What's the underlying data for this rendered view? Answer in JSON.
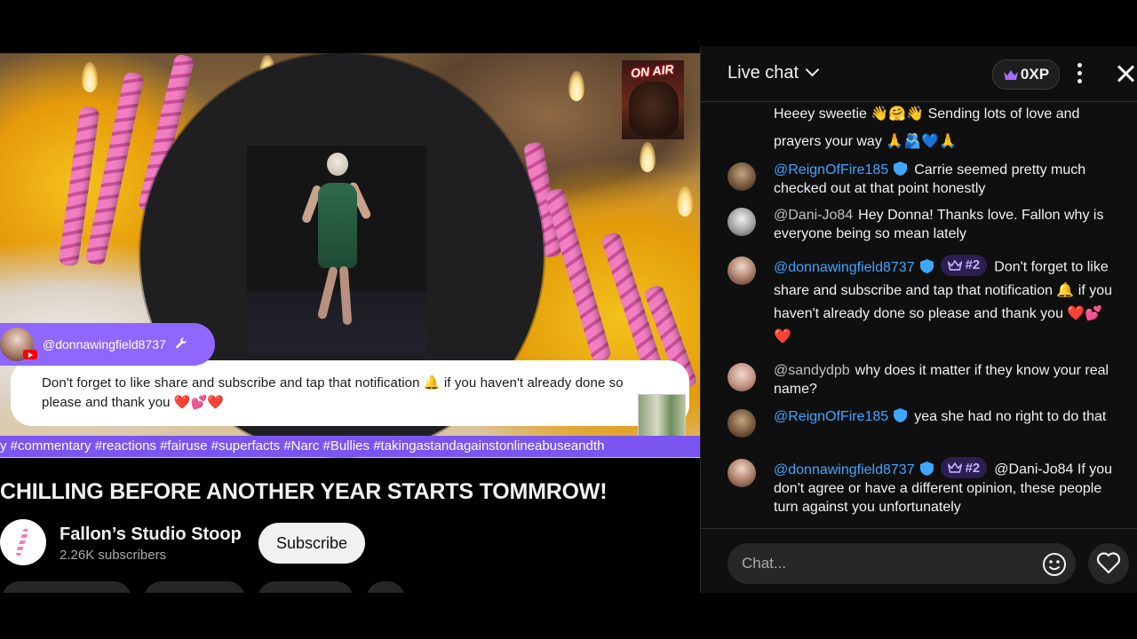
{
  "video": {
    "on_air_label": "ON AIR",
    "chat_overlay": {
      "username": "@donnawingfield8737",
      "message": "Don't forget to like share and subscribe and tap that notification 🔔 if you haven't already done so please and thank you ❤️💕❤️"
    },
    "ticker": "y #commentary #reactions #fairuse #superfacts #Narc #Bullies #takingastandagainstonlineabuseandth"
  },
  "title": "CHILLING BEFORE ANOTHER YEAR STARTS TOMMROW!",
  "channel": {
    "name": "Fallon’s Studio Stoop",
    "subscribers": "2.26K subscribers",
    "subscribe_label": "Subscribe"
  },
  "chat": {
    "title": "Live chat",
    "xp": "0XP",
    "input_placeholder": "Chat...",
    "messages": [
      {
        "author": "",
        "text": "Heeey sweetie 👋🤗👋 Sending lots of love and prayers your way 🙏🫂💙🙏"
      },
      {
        "author": "@ReignOfFire185",
        "text": "Carrie seemed pretty much checked out at that point honestly"
      },
      {
        "author": "@Dani-Jo84",
        "text": "Hey Donna! Thanks love. Fallon why is everyone being so mean lately"
      },
      {
        "author": "@donnawingfield8737",
        "rank": "#2",
        "text": "Don't forget to like share and subscribe and tap that notification 🔔 if you haven't already done so please and thank you ❤️💕❤️"
      },
      {
        "author": "@sandydpb",
        "text": "why does it matter if they know your real name?"
      },
      {
        "author": "@ReignOfFire185",
        "text": "yea she had no right to do that"
      },
      {
        "author": "@donnawingfield8737",
        "rank": "#2",
        "text": "@Dani-Jo84 If you don't agree or have a different opinion, these people turn against you unfortunately"
      }
    ]
  },
  "colors": {
    "accent_purple": "#7b55f0",
    "link_blue": "#3ea6ff",
    "chat_bg": "#0f0f0f"
  }
}
